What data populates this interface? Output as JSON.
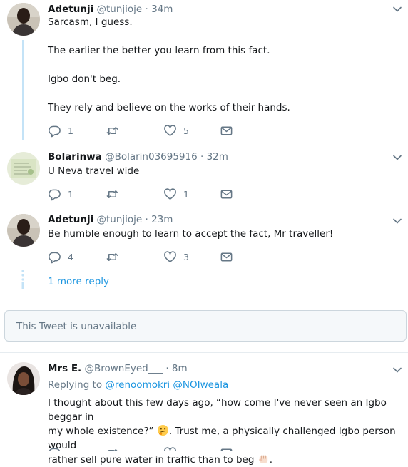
{
  "tweets": [
    {
      "name": "Adetunji",
      "handle": "@tunjioje",
      "time": "34m",
      "lines": [
        "Sarcasm, I guess.",
        "The earlier the better you learn from this fact.",
        "Igbo don't beg.",
        "They rely and believe on the works of their hands."
      ],
      "replies": "1",
      "likes": "5"
    },
    {
      "name": "Bolarinwa",
      "handle": "@Bolarin03695916",
      "time": "32m",
      "lines": [
        "U Neva travel wide"
      ],
      "replies": "1",
      "likes": "1"
    },
    {
      "name": "Adetunji",
      "handle": "@tunjioje",
      "time": "23m",
      "lines": [
        "Be humble enough to learn to accept the fact, Mr traveller!"
      ],
      "replies": "4",
      "likes": "3"
    },
    {
      "name": "Mrs E.",
      "handle": "@BrownEyed___",
      "time": "8m",
      "replying_prefix": "Replying to",
      "replying_to": [
        "@renoomokri",
        "@NOIweala"
      ],
      "lines": [
        "I thought about this few days ago, “how come I've never seen an Igbo beggar in",
        "my whole existence?”",
        ". Trust me, a physically challenged Igbo person would",
        "rather sell pure water in traffic than to beg",
        "."
      ]
    }
  ],
  "separator": "·",
  "more_reply_label": "1 more reply",
  "unavailable_label": "This Tweet is unavailable",
  "icons": [
    "reply-icon",
    "retweet-icon",
    "like-icon",
    "message-icon",
    "caret-down-icon",
    "thinking-face-emoji",
    "raised-fist-emoji"
  ],
  "colors": {
    "accent": "#1b95e0",
    "muted": "#657786",
    "thread_line": "#c4e3f7",
    "text": "#14171a"
  }
}
